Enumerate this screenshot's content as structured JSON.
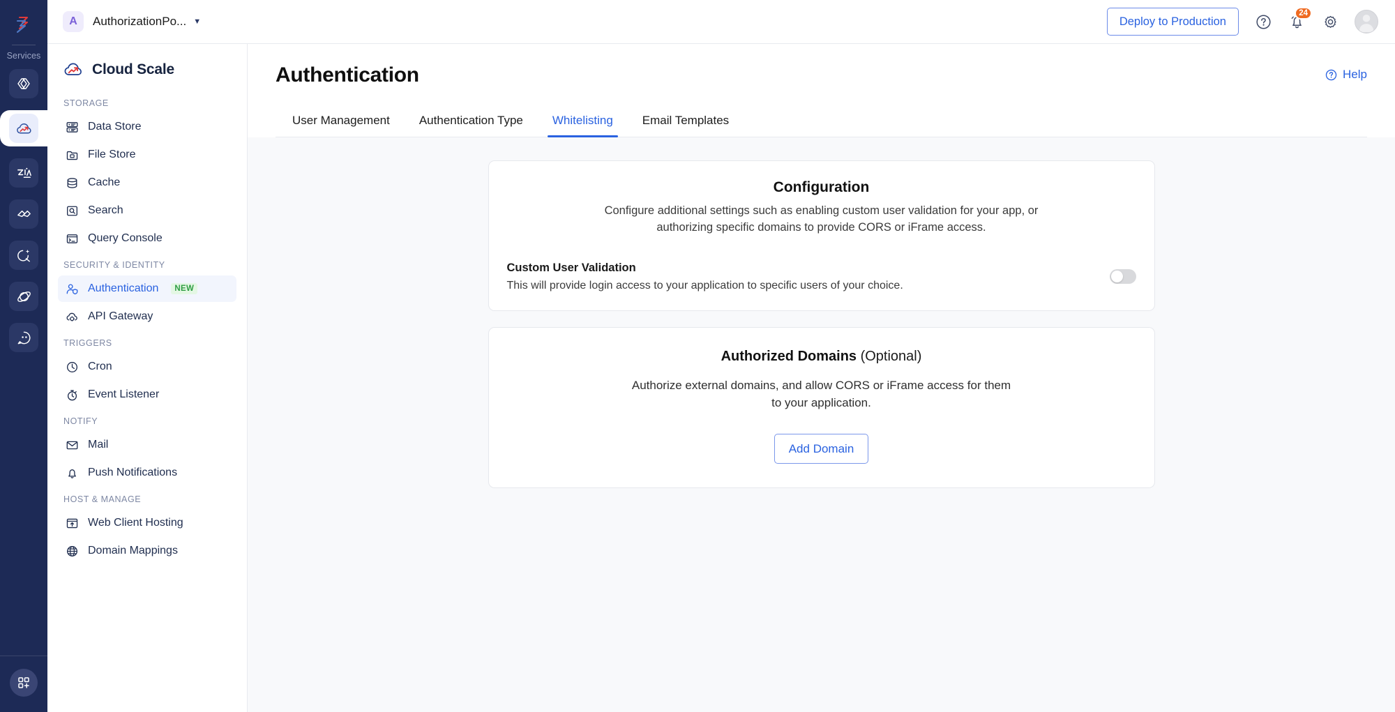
{
  "rail": {
    "services_label": "Services",
    "logo_icon": "catalyst-logo-icon",
    "tiles": [
      {
        "name": "rail-tile-code",
        "icon": "code-brackets-icon",
        "active": false
      },
      {
        "name": "rail-tile-cloud-scale",
        "icon": "cloud-scale-icon",
        "active": true
      },
      {
        "name": "rail-tile-zia",
        "icon": "zia-icon",
        "active": false
      },
      {
        "name": "rail-tile-serverless",
        "icon": "serverless-icon",
        "active": false
      },
      {
        "name": "rail-tile-quickml",
        "icon": "quickml-sparkle-icon",
        "active": false
      },
      {
        "name": "rail-tile-embedded",
        "icon": "embedded-orbit-icon",
        "active": false
      },
      {
        "name": "rail-tile-chat",
        "icon": "chat-bot-icon",
        "active": false
      }
    ],
    "apps_icon": "add-apps-grid-icon"
  },
  "topbar": {
    "project_initial": "A",
    "project_name": "AuthorizationPo...",
    "project_caret_icon": "chevron-down-icon",
    "deploy_label": "Deploy to Production",
    "help_icon": "help-circle-icon",
    "notifications_icon": "bell-icon",
    "notifications_count": "24",
    "settings_icon": "gear-icon",
    "avatar_icon": "user-avatar-icon"
  },
  "sidebar": {
    "product_name": "Cloud Scale",
    "product_icon": "cloud-scale-logo-icon",
    "groups": [
      {
        "title": "STORAGE",
        "items": [
          {
            "label": "Data Store",
            "icon": "data-store-icon",
            "active": false,
            "badge": ""
          },
          {
            "label": "File Store",
            "icon": "file-store-icon",
            "active": false,
            "badge": ""
          },
          {
            "label": "Cache",
            "icon": "cache-database-icon",
            "active": false,
            "badge": ""
          },
          {
            "label": "Search",
            "icon": "search-icon",
            "active": false,
            "badge": ""
          },
          {
            "label": "Query Console",
            "icon": "query-console-icon",
            "active": false,
            "badge": ""
          }
        ]
      },
      {
        "title": "SECURITY & IDENTITY",
        "items": [
          {
            "label": "Authentication",
            "icon": "authentication-user-shield-icon",
            "active": true,
            "badge": "NEW"
          },
          {
            "label": "API Gateway",
            "icon": "api-gateway-icon",
            "active": false,
            "badge": ""
          }
        ]
      },
      {
        "title": "TRIGGERS",
        "items": [
          {
            "label": "Cron",
            "icon": "clock-icon",
            "active": false,
            "badge": ""
          },
          {
            "label": "Event Listener",
            "icon": "stopwatch-icon",
            "active": false,
            "badge": ""
          }
        ]
      },
      {
        "title": "NOTIFY",
        "items": [
          {
            "label": "Mail",
            "icon": "mail-envelope-icon",
            "active": false,
            "badge": ""
          },
          {
            "label": "Push Notifications",
            "icon": "bell-icon",
            "active": false,
            "badge": ""
          }
        ]
      },
      {
        "title": "HOST & MANAGE",
        "items": [
          {
            "label": "Web Client Hosting",
            "icon": "web-client-hosting-icon",
            "active": false,
            "badge": ""
          },
          {
            "label": "Domain Mappings",
            "icon": "globe-icon",
            "active": false,
            "badge": ""
          }
        ]
      }
    ]
  },
  "page": {
    "title": "Authentication",
    "help_label": "Help",
    "help_icon": "help-circle-icon",
    "tabs": [
      {
        "label": "User Management",
        "active": false
      },
      {
        "label": "Authentication Type",
        "active": false
      },
      {
        "label": "Whitelisting",
        "active": true
      },
      {
        "label": "Email Templates",
        "active": false
      }
    ]
  },
  "configuration_card": {
    "title": "Configuration",
    "description": "Configure additional settings such as enabling custom user validation for your app, or authorizing specific domains to provide CORS or iFrame access.",
    "setting_name": "Custom User Validation",
    "setting_description": "This will provide login access to your application to specific users of your choice.",
    "toggle_state": "off"
  },
  "authorized_domains_card": {
    "title_bold": "Authorized Domains ",
    "title_regular": "(Optional)",
    "description": "Authorize external domains, and allow CORS or iFrame access for them to your application.",
    "add_button_label": "Add Domain"
  },
  "colors": {
    "accent_blue": "#2a62e0",
    "rail_navy": "#1d2a56",
    "badge_orange": "#ef6b22",
    "new_green": "#2f9e44",
    "panel_bg": "#f8f9fb"
  }
}
